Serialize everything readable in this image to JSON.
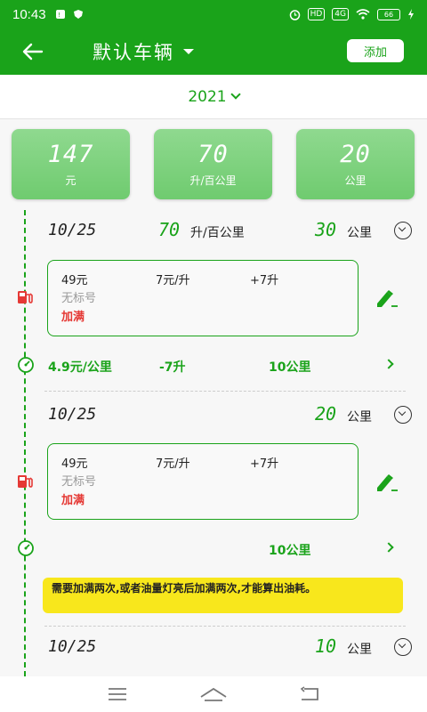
{
  "status": {
    "time": "10:43",
    "battery": "66"
  },
  "appbar": {
    "title": "默认车辆",
    "add_label": "添加"
  },
  "year": "2021",
  "summary": [
    {
      "value": "147",
      "unit": "元"
    },
    {
      "value": "70",
      "unit": "升/百公里"
    },
    {
      "value": "20",
      "unit": "公里"
    }
  ],
  "groups": [
    {
      "date": "10/25",
      "consumption": "70",
      "consumption_unit": "升/百公里",
      "distance": "30",
      "distance_unit": "公里",
      "record": {
        "amount": "49元",
        "price": "7元/升",
        "volume": "+7升",
        "grade": "无标号",
        "fill": "加满"
      },
      "stats": {
        "cost_per_km": "4.9元/公里",
        "fuel_diff": "-7升",
        "dist": "10公里"
      }
    },
    {
      "date": "10/25",
      "distance": "20",
      "distance_unit": "公里",
      "record": {
        "amount": "49元",
        "price": "7元/升",
        "volume": "+7升",
        "grade": "无标号",
        "fill": "加满"
      },
      "stats": {
        "dist": "10公里"
      }
    },
    {
      "date": "10/25",
      "distance": "10",
      "distance_unit": "公里"
    }
  ],
  "notice": "需要加满两次,或者油量灯亮后加满两次,才能算出油耗。",
  "colors": {
    "primary": "#1aa31a",
    "card": "#7fd27f",
    "warning": "#f8e71c",
    "alert": "#e53935"
  }
}
